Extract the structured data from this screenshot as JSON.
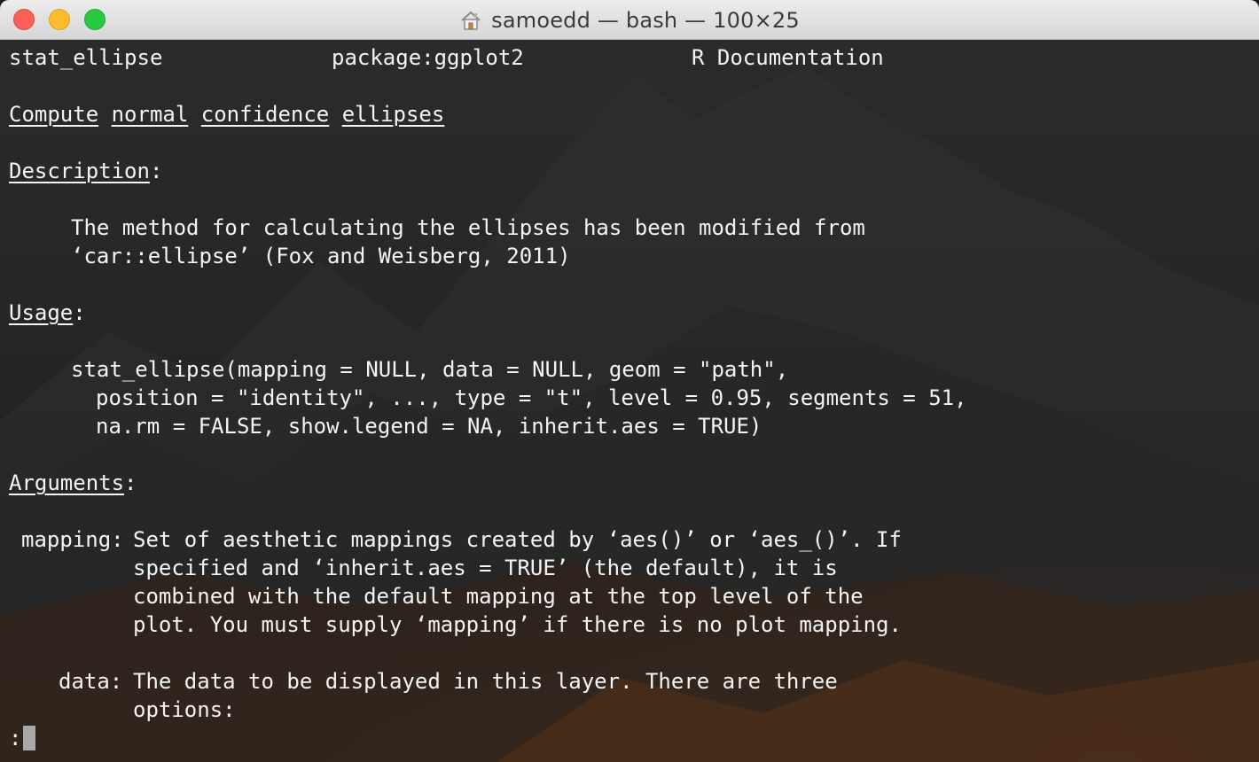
{
  "window": {
    "title": "samoedd — bash — 100×25"
  },
  "terminal": {
    "header": {
      "topic": "stat_ellipse",
      "package": "package:ggplot2",
      "doc": "R Documentation"
    },
    "heading_words": [
      "Compute",
      "normal",
      "confidence",
      "ellipses"
    ],
    "sections": {
      "description": "Description",
      "usage": "Usage",
      "arguments": "Arguments"
    },
    "description_lines": [
      "The method for calculating the ellipses has been modified from",
      "‘car::ellipse’ (Fox and Weisberg, 2011)"
    ],
    "usage_lines": [
      "stat_ellipse(mapping = NULL, data = NULL, geom = \"path\",",
      "position = \"identity\", ..., type = \"t\", level = 0.95, segments = 51,",
      "na.rm = FALSE, show.legend = NA, inherit.aes = TRUE)"
    ],
    "arguments": [
      {
        "name": "mapping",
        "lines": [
          "Set of aesthetic mappings created by ‘aes()’ or ‘aes_()’. If",
          "specified and ‘inherit.aes = TRUE’ (the default), it is",
          "combined with the default mapping at the top level of the",
          "plot. You must supply ‘mapping’ if there is no plot mapping."
        ]
      },
      {
        "name": "data",
        "lines": [
          "The data to be displayed in this layer. There are three",
          "options:"
        ]
      }
    ],
    "prompt": ":",
    "colon": ":"
  }
}
